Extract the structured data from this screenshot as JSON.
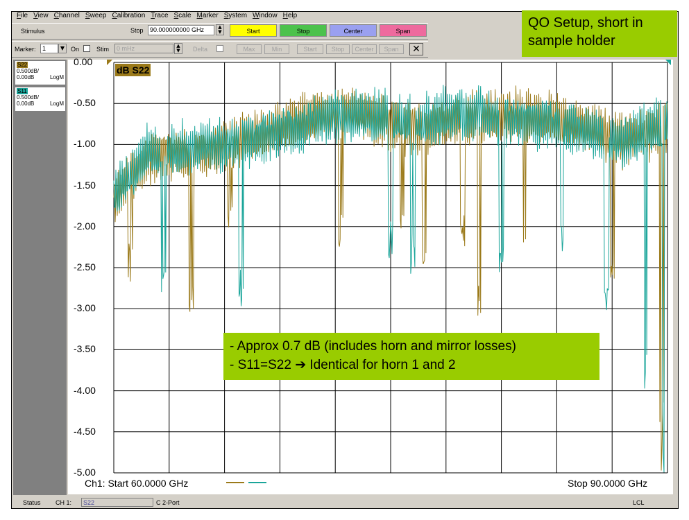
{
  "menu": [
    "File",
    "View",
    "Channel",
    "Sweep",
    "Calibration",
    "Trace",
    "Scale",
    "Marker",
    "System",
    "Window",
    "Help"
  ],
  "stimulus_bar": {
    "stimulus_label": "Stimulus",
    "stop_label": "Stop",
    "stop_value": "90.000000000 GHz",
    "buttons": [
      {
        "label": "Start",
        "color": "#ffff00"
      },
      {
        "label": "Stop",
        "color": "#4cc24c"
      },
      {
        "label": "Center",
        "color": "#9aa0f0"
      },
      {
        "label": "Span",
        "color": "#ee6a9e"
      }
    ]
  },
  "marker_bar": {
    "marker_label": "Marker:",
    "marker_value": "1",
    "on_label": "On",
    "stim_label": "Stim",
    "stim_value": "0 mHz",
    "delta_label": "Delta",
    "buttons": [
      "Max",
      "Min",
      "Start",
      "Stop",
      "Center",
      "Span"
    ],
    "close_glyph": "✕"
  },
  "traces": [
    {
      "name": "S22",
      "scale": "0.500dB/",
      "ref": "0.00dB",
      "format": "LogM",
      "color": "#9b7a1a"
    },
    {
      "name": "S11",
      "scale": "0.500dB/",
      "ref": "0.00dB",
      "format": "LogM",
      "color": "#1aa59a"
    }
  ],
  "plot": {
    "trace_label": "dB S22",
    "y_ticks": [
      "0.00",
      "-0.50",
      "-1.00",
      "-1.50",
      "-2.00",
      "-2.50",
      "-3.00",
      "-3.50",
      "-4.00",
      "-4.50",
      "-5.00"
    ],
    "start_text": "Ch1: Start  60.0000 GHz",
    "stop_text": "Stop  90.0000 GHz"
  },
  "status_bar": {
    "status": "Status",
    "channel": "CH 1:",
    "trace": "S22",
    "mode": "C  2-Port",
    "lcl": "LCL"
  },
  "callouts": {
    "title": "QO Setup, short in sample holder",
    "line1": "- Approx 0.7 dB (includes horn and mirror losses)",
    "line2_a": "- S11=S22",
    "line2_arrow": "➔",
    "line2_b": "Identical for horn 1 and 2"
  }
}
